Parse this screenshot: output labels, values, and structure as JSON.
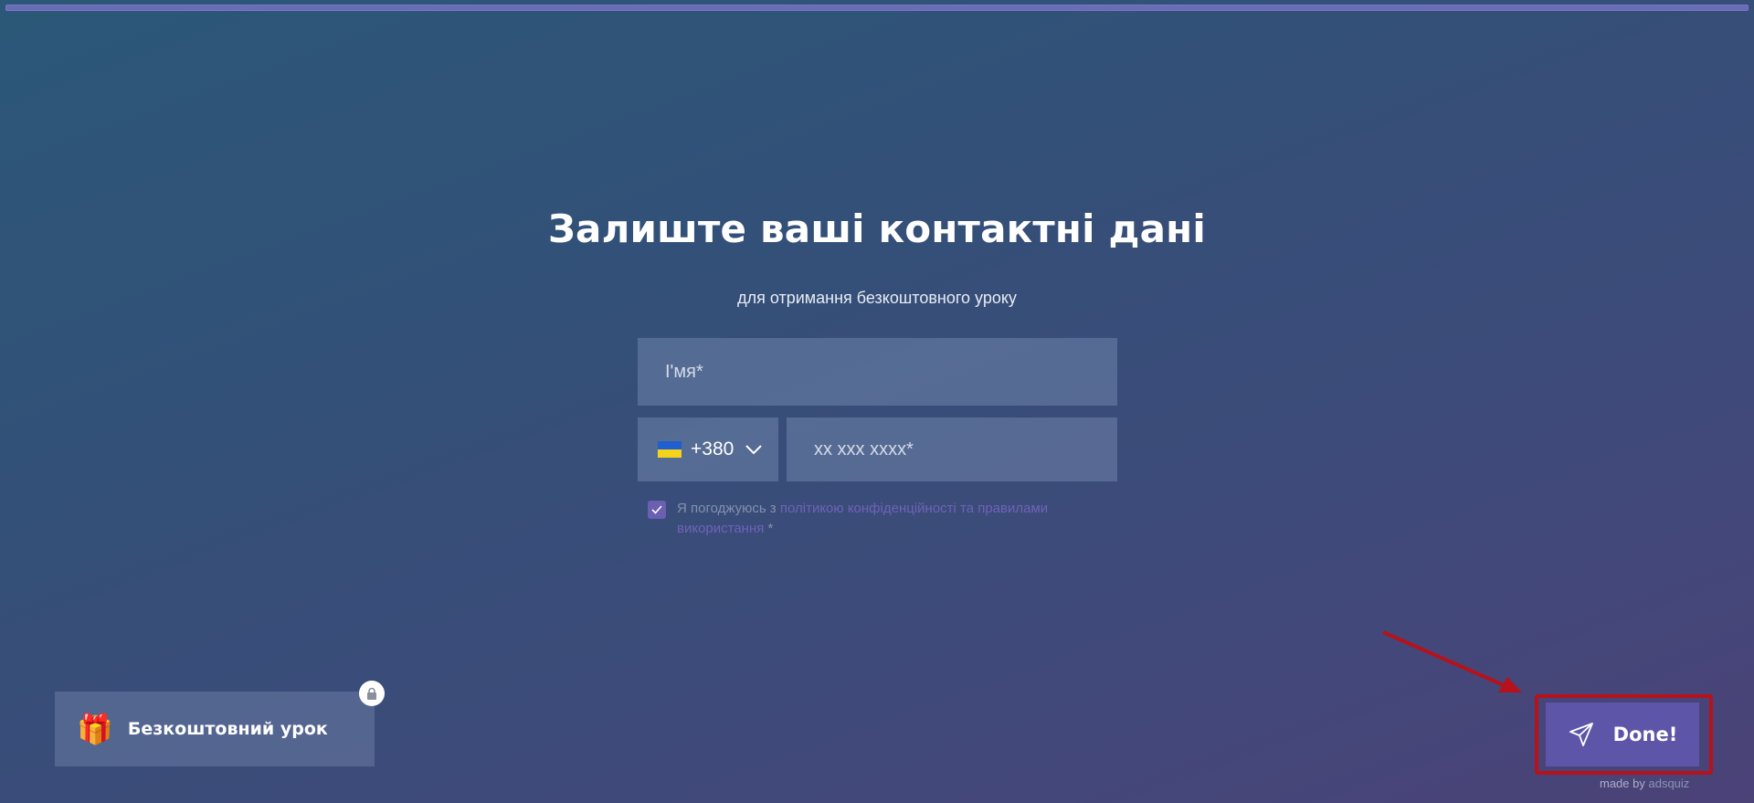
{
  "progress": {
    "fraction": 1.0
  },
  "form": {
    "title": "Залиште ваші контактні дані",
    "subtitle": "для отримання безкоштовного уроку",
    "name_placeholder": "І'мя*",
    "phone": {
      "country_flag": "ukraine-flag",
      "dial_code": "+380",
      "placeholder": "xx xxx xxxx*"
    },
    "consent": {
      "checked": true,
      "text_before": "Я погоджуюсь з ",
      "link_text": "політикою конфіденційності та правилами використання",
      "text_after": " *"
    }
  },
  "bonus": {
    "label": "Безкоштовний урок",
    "icon": "gift-icon",
    "badge_icon": "lock-icon"
  },
  "submit": {
    "label": "Done!",
    "icon": "send-icon"
  },
  "credit": {
    "prefix": "made by ",
    "brand": "adsquiz"
  },
  "colors": {
    "button": "#5d55a8",
    "annotation": "#b5121b",
    "checkbox": "#6a5fb0",
    "link": "#6f62b8"
  }
}
